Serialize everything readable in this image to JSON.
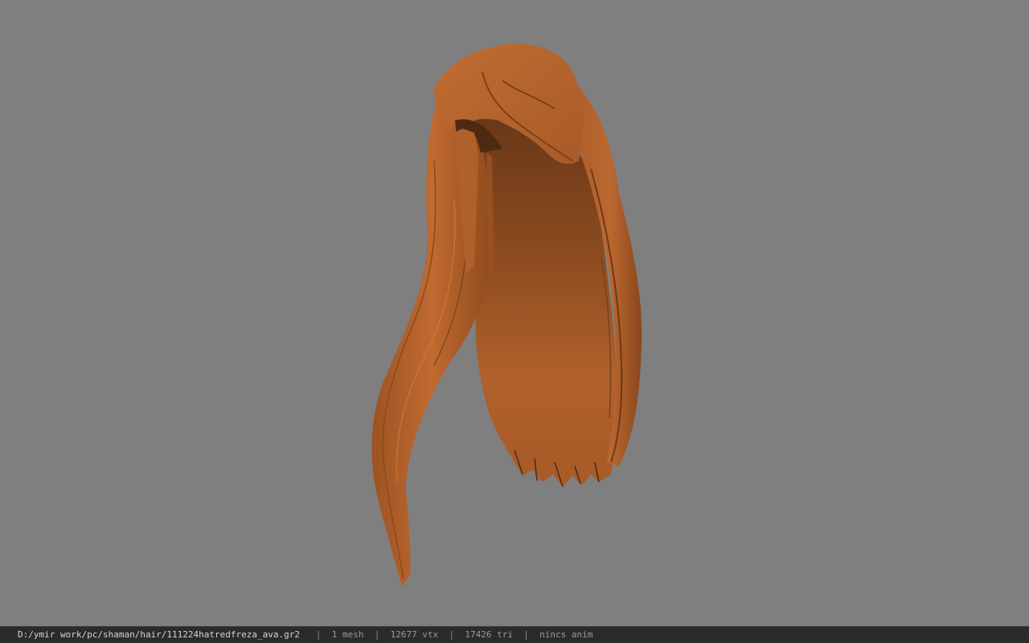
{
  "viewport": {
    "background_color": "#7f7f7f",
    "model": {
      "name": "hair-mesh",
      "base_color": "#b8652d",
      "shadow_color": "#5e3214"
    }
  },
  "statusbar": {
    "file_path": "D:/ymir work/pc/shaman/hair/111224hatredfreza_ava.gr2",
    "separator": "|",
    "mesh_count": "1 mesh",
    "vertex_count": "12677 vtx",
    "triangle_count": "17426 tri",
    "anim_status": "nincs anim"
  }
}
